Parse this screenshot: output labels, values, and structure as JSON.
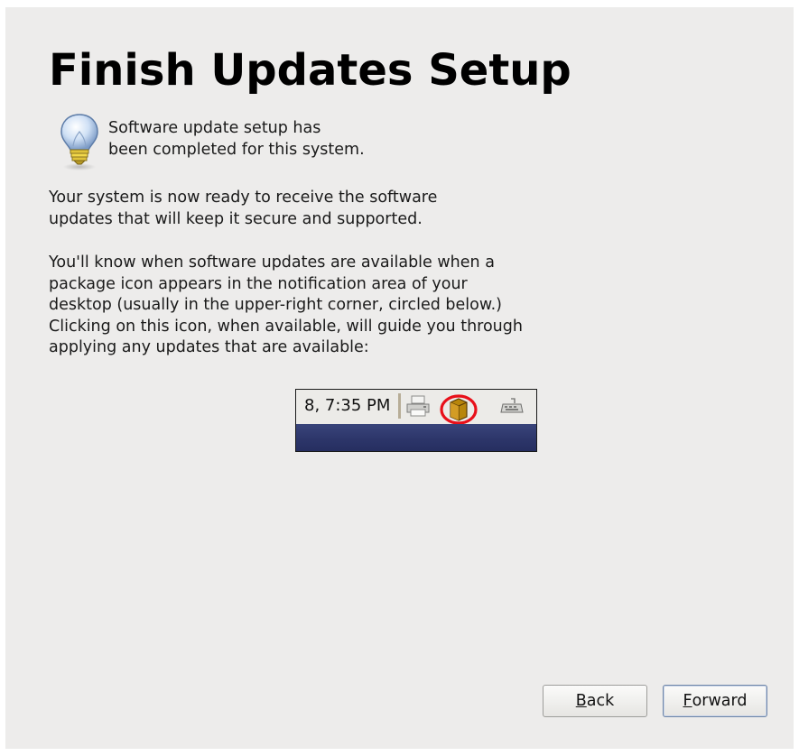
{
  "page": {
    "title": "Finish Updates Setup"
  },
  "info": {
    "icon": "lightbulb-icon",
    "text": "Software update setup has\nbeen completed for this system."
  },
  "paragraphs": [
    "Your system is now ready to receive the software\nupdates that will keep it secure and supported.",
    "You'll know when software updates are available when a\npackage icon appears in the notification area of your\ndesktop (usually in the upper-right corner, circled below.)\nClicking on this icon, when available, will guide you through\napplying any updates that are available:"
  ],
  "panel_example": {
    "clock": "8,  7:35 PM",
    "icons": [
      "printer-icon",
      "package-icon",
      "keyboard-icon"
    ],
    "highlight_color": "#e8101a",
    "package_color": "#b8860b"
  },
  "buttons": {
    "back": {
      "mnemonic": "B",
      "rest": "ack"
    },
    "forward": {
      "mnemonic": "F",
      "rest": "orward"
    }
  },
  "colors": {
    "window_bg": "#edeceb",
    "focus_border": "#6f86a8"
  }
}
